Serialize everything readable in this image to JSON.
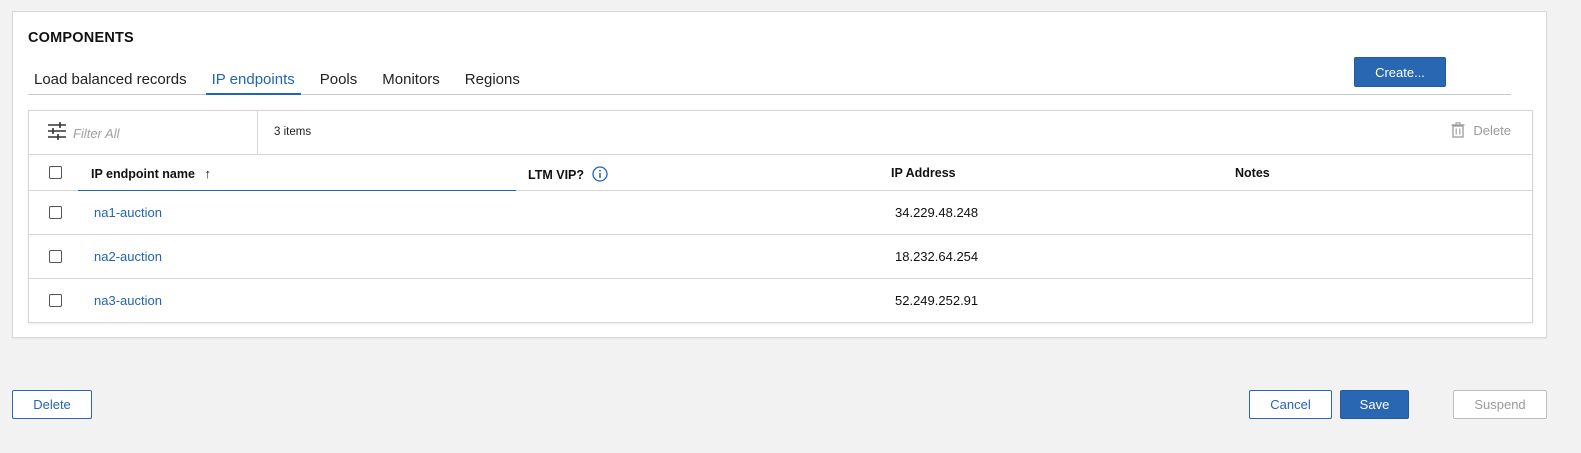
{
  "section": {
    "title": "COMPONENTS"
  },
  "tabs": [
    {
      "label": "Load balanced records"
    },
    {
      "label": "IP endpoints",
      "active": true
    },
    {
      "label": "Pools"
    },
    {
      "label": "Monitors"
    },
    {
      "label": "Regions"
    }
  ],
  "create_button": "Create...",
  "toolbar": {
    "filter_placeholder": "Filter All",
    "items_count": "3 items",
    "delete_label": "Delete",
    "filter_icon": "sliders-icon",
    "delete_icon": "trash-icon"
  },
  "table": {
    "columns": [
      {
        "label": "IP endpoint name",
        "sort": "ascending"
      },
      {
        "label": "LTM VIP?",
        "icon": "info-icon"
      },
      {
        "label": "IP Address"
      },
      {
        "label": "Notes"
      }
    ],
    "rows": [
      {
        "name": "na1-auction",
        "ltm_vip": "",
        "ip": "34.229.48.248",
        "notes": ""
      },
      {
        "name": "na2-auction",
        "ltm_vip": "",
        "ip": "18.232.64.254",
        "notes": ""
      },
      {
        "name": "na3-auction",
        "ltm_vip": "",
        "ip": "52.249.252.91",
        "notes": ""
      }
    ]
  },
  "footer": {
    "delete_label": "Delete",
    "cancel_label": "Cancel",
    "save_label": "Save",
    "suspend_label": "Suspend"
  },
  "colors": {
    "accent": "#2264b5",
    "primary_button": "#2a67b2",
    "background": "#f2f2f2"
  }
}
